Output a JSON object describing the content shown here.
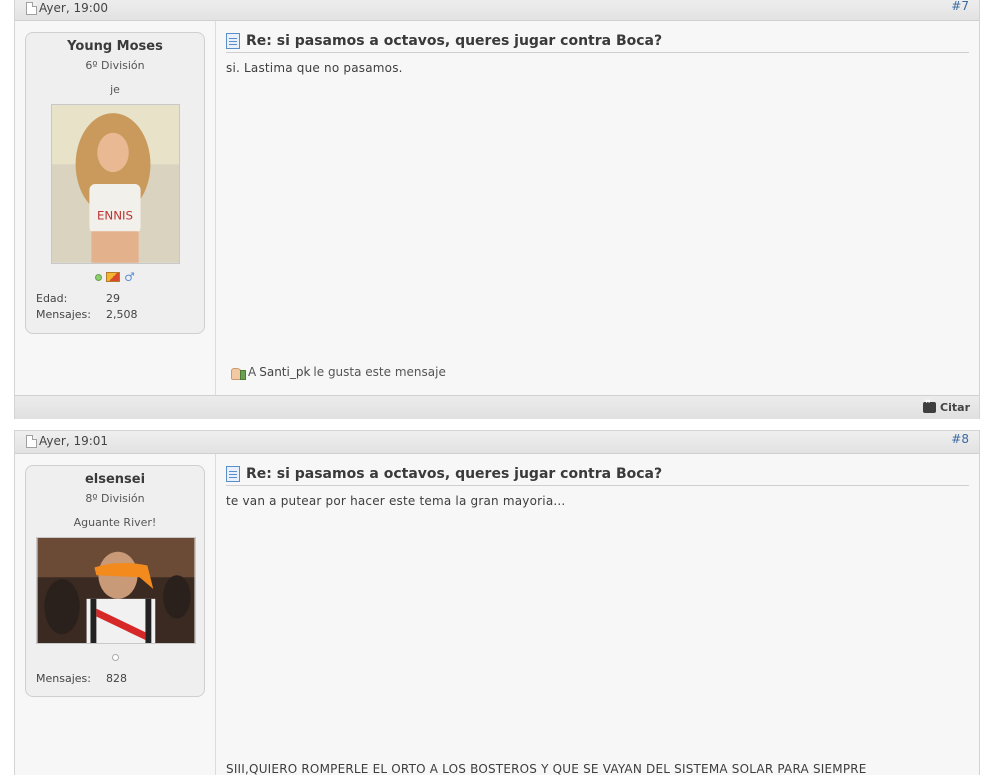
{
  "posts": [
    {
      "date": "Ayer, 19:00",
      "number": "#7",
      "user": {
        "name": "Young Moses",
        "rank": "6º División",
        "title": "je",
        "stats": [
          {
            "label": "Edad:",
            "value": "29"
          },
          {
            "label": "Mensajes:",
            "value": "2,508"
          }
        ]
      },
      "title": "Re: si pasamos a octavos, queres jugar contra Boca?",
      "text": "si. Lastima que no pasamos.",
      "likes": {
        "prefix": "A",
        "user": "Santi_pk",
        "suffix": "le gusta este mensaje"
      },
      "quote_label": "Citar"
    },
    {
      "date": "Ayer, 19:01",
      "number": "#8",
      "user": {
        "name": "elsensei",
        "rank": "8º División",
        "title": "Aguante River!",
        "stats": [
          {
            "label": "Mensajes:",
            "value": "828"
          }
        ]
      },
      "title": "Re: si pasamos a octavos, queres jugar contra Boca?",
      "text": "te van a putear por hacer este tema la gran mayoria...",
      "signature": "SIII,QUIERO ROMPERLE EL ORTO A LOS BOSTEROS Y QUE SE VAYAN DEL SISTEMA SOLAR PARA SIEMPRE"
    }
  ],
  "icons": {
    "online": "online-status-icon",
    "offline": "offline-status-icon",
    "flag": "country-flag-icon",
    "gender": "male-icon",
    "like": "thumbs-up-icon",
    "quote": "quote-icon",
    "document": "document-icon"
  },
  "colors": {
    "post_number": "#3b6aa0",
    "online_dot": "#8bd06c"
  }
}
